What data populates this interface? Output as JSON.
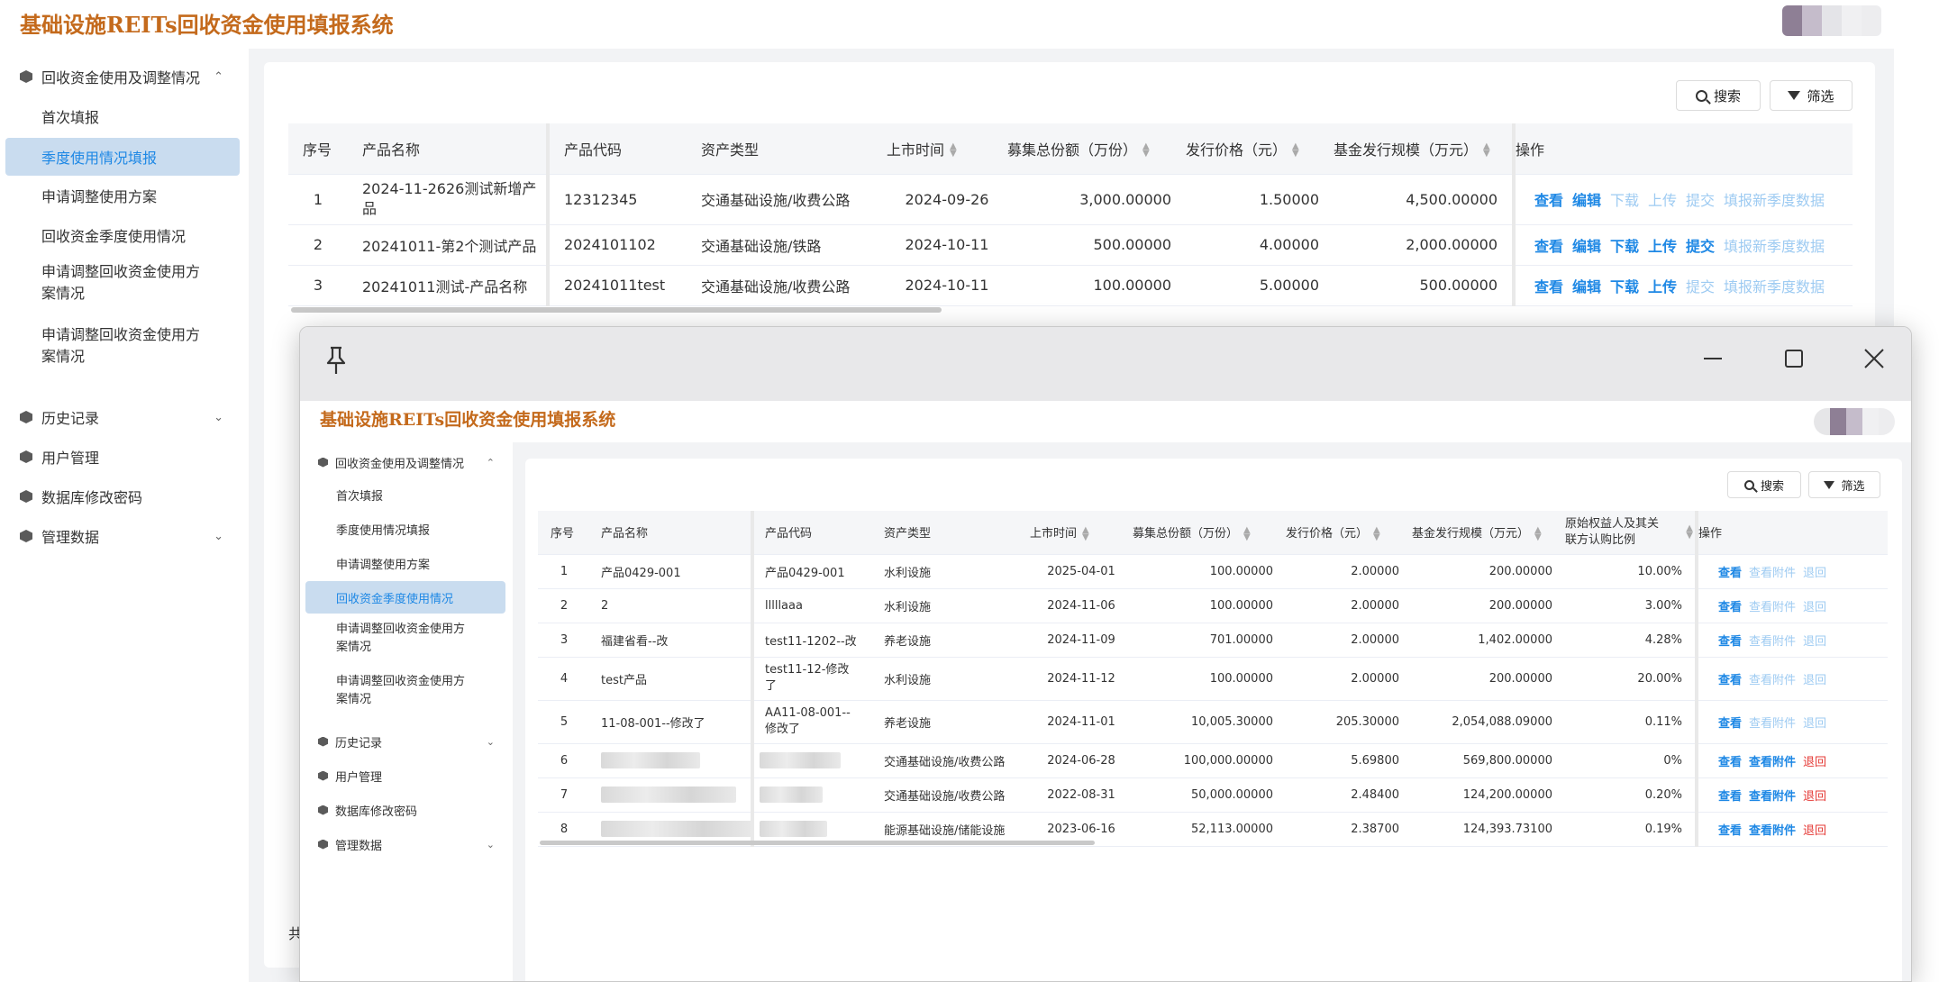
{
  "app": {
    "title": "基础设施REITs回收资金使用填报系统",
    "avatar_colors": [
      "#8e7f95",
      "#c5bccb",
      "#e4e4e8",
      "#f0f0f2",
      "#ededef"
    ]
  },
  "background": {
    "sidebar": {
      "group1": {
        "label": "回收资金使用及调整情况",
        "chevron": "⌃"
      },
      "items": [
        {
          "label": "首次填报"
        },
        {
          "label": "季度使用情况填报",
          "active": true
        },
        {
          "label": "申请调整使用方案"
        },
        {
          "label": "回收资金季度使用情况"
        },
        {
          "label": "申请调整回收资金使用方",
          "label2": "案情况"
        },
        {
          "label": "申请调整回收资金使用方",
          "label2": "案情况"
        }
      ],
      "history": {
        "label": "历史记录",
        "chevron": "⌄"
      },
      "users": {
        "label": "用户管理"
      },
      "db_password": {
        "label": "数据库修改密码"
      },
      "manage": {
        "label": "管理数据",
        "chevron": "⌄"
      }
    },
    "toolbar": {
      "search": "搜索",
      "filter": "筛选"
    },
    "table": {
      "headers": [
        "序号",
        "产品名称",
        "产品代码",
        "资产类型",
        "上市时间",
        "募集总份额（万份）",
        "发行价格（元）",
        "基金发行规模（万元）",
        "操作"
      ],
      "rows": [
        {
          "idx": "1",
          "name": "2024-11-2626测试新增产",
          "name2": "品",
          "code": "12312345",
          "type": "交通基础设施/收费公路",
          "date": "2024-09-26",
          "shares": "3,000.00000",
          "price": "1.50000",
          "scale": "4,500.00000"
        },
        {
          "idx": "2",
          "name": "20241011-第2个测试产品",
          "name2": "",
          "code": "2024101102",
          "type": "交通基础设施/铁路",
          "date": "2024-10-11",
          "shares": "500.00000",
          "price": "4.00000",
          "scale": "2,000.00000"
        },
        {
          "idx": "3",
          "name": "20241011测试-产品名称",
          "name2": "",
          "code": "20241011test",
          "type": "交通基础设施/收费公路",
          "date": "2024-10-11",
          "shares": "100.00000",
          "price": "5.00000",
          "scale": "500.00000"
        }
      ],
      "ops": {
        "view": "查看",
        "edit": "编辑",
        "download": "下载",
        "upload": "上传",
        "submit": "提交",
        "fill": "填报新季度数据"
      }
    },
    "footer_text": "共"
  },
  "window": {
    "controls": {
      "pin": "📌",
      "minimize": "—",
      "maximize": "☐",
      "close": "✕"
    },
    "sidebar": {
      "group1": {
        "label": "回收资金使用及调整情况",
        "chevron": "⌃"
      },
      "items": [
        {
          "label": "首次填报"
        },
        {
          "label": "季度使用情况填报"
        },
        {
          "label": "申请调整使用方案"
        },
        {
          "label": "回收资金季度使用情况",
          "active": true
        },
        {
          "label": "申请调整回收资金使用方",
          "label2": "案情况"
        },
        {
          "label": "申请调整回收资金使用方",
          "label2": "案情况"
        }
      ],
      "history": {
        "label": "历史记录",
        "chevron": "⌄"
      },
      "users": {
        "label": "用户管理"
      },
      "db_password": {
        "label": "数据库修改密码"
      },
      "manage": {
        "label": "管理数据",
        "chevron": "⌄"
      }
    },
    "toolbar": {
      "search": "搜索",
      "filter": "筛选"
    },
    "table": {
      "headers": [
        "序号",
        "产品名称",
        "产品代码",
        "资产类型",
        "上市时间",
        "募集总份额（万份）",
        "发行价格（元）",
        "基金发行规模（万元）",
        "原始权益人及其关",
        "联方认购比例",
        "操作"
      ],
      "rows": [
        {
          "idx": "1",
          "name": "产品0429-001",
          "code": "产品0429-001",
          "code2": "",
          "type": "水利设施",
          "date": "2025-04-01",
          "shares": "100.00000",
          "price": "2.00000",
          "scale": "200.00000",
          "ratio": "10.00%",
          "enabled": false
        },
        {
          "idx": "2",
          "name": "2",
          "code": "lllllaaa",
          "code2": "",
          "type": "水利设施",
          "date": "2024-11-06",
          "shares": "100.00000",
          "price": "2.00000",
          "scale": "200.00000",
          "ratio": "3.00%",
          "enabled": false
        },
        {
          "idx": "3",
          "name": "福建省看--改",
          "code": "test11-1202--改",
          "code2": "",
          "type": "养老设施",
          "date": "2024-11-09",
          "shares": "701.00000",
          "price": "2.00000",
          "scale": "1,402.00000",
          "ratio": "4.28%",
          "enabled": false
        },
        {
          "idx": "4",
          "name": "test产品",
          "code": "test11-12-修改",
          "code2": "了",
          "type": "水利设施",
          "date": "2024-11-12",
          "shares": "100.00000",
          "price": "2.00000",
          "scale": "200.00000",
          "ratio": "20.00%",
          "enabled": false
        },
        {
          "idx": "5",
          "name": "11-08-001--修改了",
          "code": "AA11-08-001--",
          "code2": "修改了",
          "type": "养老设施",
          "date": "2024-11-01",
          "shares": "10,005.30000",
          "price": "205.30000",
          "scale": "2,054,088.09000",
          "ratio": "0.11%",
          "enabled": false
        },
        {
          "idx": "6",
          "name": "",
          "code": "",
          "code2": "",
          "type": "交通基础设施/收费公路",
          "date": "2024-06-28",
          "shares": "100,000.00000",
          "price": "5.69800",
          "scale": "569,800.00000",
          "ratio": "0%",
          "enabled": true
        },
        {
          "idx": "7",
          "name": "",
          "code": "",
          "code2": "",
          "type": "交通基础设施/收费公路",
          "date": "2022-08-31",
          "shares": "50,000.00000",
          "price": "2.48400",
          "scale": "124,200.00000",
          "ratio": "0.20%",
          "enabled": true
        },
        {
          "idx": "8",
          "name": "",
          "code": "",
          "code2": "",
          "type": "能源基础设施/储能设施",
          "date": "2023-06-16",
          "shares": "52,113.00000",
          "price": "2.38700",
          "scale": "124,393.73100",
          "ratio": "0.19%",
          "enabled": true
        }
      ],
      "ops": {
        "view": "查看",
        "attachment": "查看附件",
        "return": "退回"
      }
    }
  }
}
